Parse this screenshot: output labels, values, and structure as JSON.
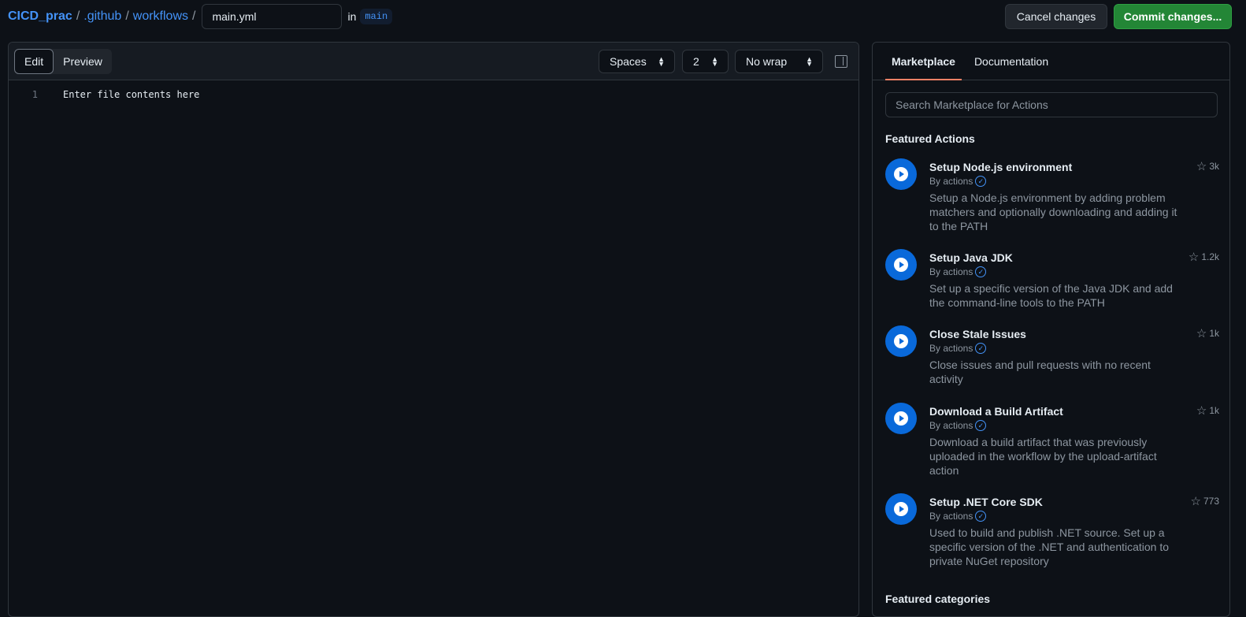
{
  "breadcrumb": {
    "repo": "CICD_prac",
    "folder1": ".github",
    "folder2": "workflows",
    "sep": "/",
    "filename": "main.yml",
    "in_label": "in",
    "branch": "main"
  },
  "header": {
    "cancel": "Cancel changes",
    "commit": "Commit changes..."
  },
  "editor": {
    "tabs": {
      "edit": "Edit",
      "preview": "Preview"
    },
    "indent_mode": "Spaces",
    "indent_size": "2",
    "wrap_mode": "No wrap",
    "lines": [
      {
        "num": "1",
        "text": "Enter file contents here"
      }
    ]
  },
  "sidebar": {
    "tabs": {
      "marketplace": "Marketplace",
      "documentation": "Documentation"
    },
    "search_placeholder": "Search Marketplace for Actions",
    "featured_actions": "Featured Actions",
    "featured_categories": "Featured categories",
    "actions": [
      {
        "title": "Setup Node.js environment",
        "by": "By actions",
        "desc": "Setup a Node.js environment by adding problem matchers and optionally downloading and adding it to the PATH",
        "stars": "3k"
      },
      {
        "title": "Setup Java JDK",
        "by": "By actions",
        "desc": "Set up a specific version of the Java JDK and add the command-line tools to the PATH",
        "stars": "1.2k"
      },
      {
        "title": "Close Stale Issues",
        "by": "By actions",
        "desc": "Close issues and pull requests with no recent activity",
        "stars": "1k"
      },
      {
        "title": "Download a Build Artifact",
        "by": "By actions",
        "desc": "Download a build artifact that was previously uploaded in the workflow by the upload-artifact action",
        "stars": "1k"
      },
      {
        "title": "Setup .NET Core SDK",
        "by": "By actions",
        "desc": "Used to build and publish .NET source. Set up a specific version of the .NET and authentication to private NuGet repository",
        "stars": "773"
      }
    ]
  }
}
